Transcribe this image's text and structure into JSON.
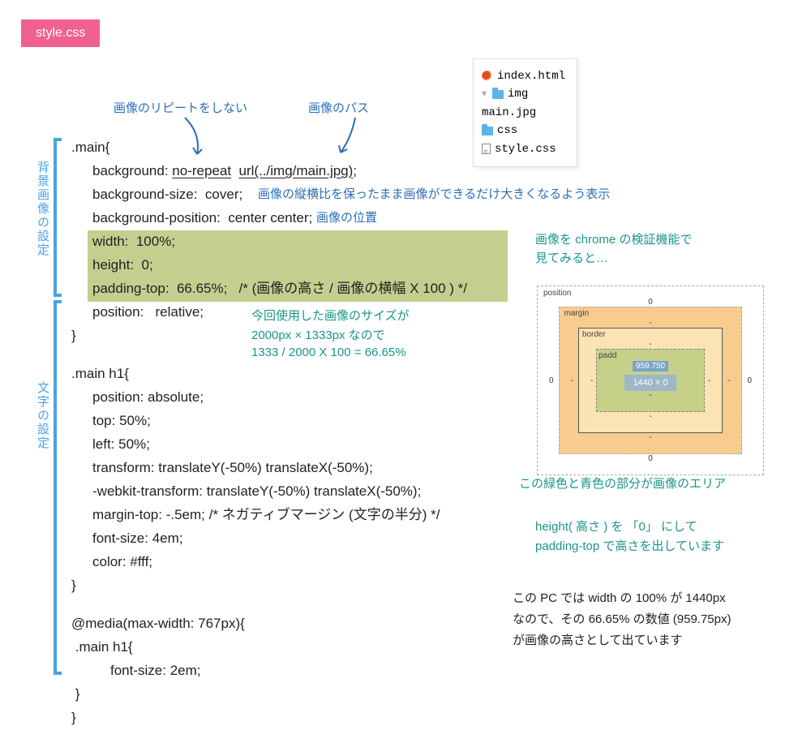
{
  "badge": {
    "label": "style.css"
  },
  "filetree": {
    "items": [
      {
        "icon": "html",
        "name": "index.html",
        "indent": 0
      },
      {
        "icon": "folder",
        "name": "img",
        "indent": 0,
        "expand": true
      },
      {
        "icon": "none",
        "name": "main.jpg",
        "indent": 1
      },
      {
        "icon": "folder",
        "name": "css",
        "indent": 0
      },
      {
        "icon": "css",
        "name": "style.css",
        "indent": 1
      }
    ]
  },
  "annotations": {
    "norepeat": "画像のリピートをしない",
    "path": "画像のパス",
    "cover": "画像の縦横比を保ったまま画像ができるだけ大きくなるよう表示",
    "position": "画像の位置",
    "chrome1": "画像を chrome の検証機能で",
    "chrome2": "見てみると…",
    "calc1": "今回使用した画像のサイズが",
    "calc2": "2000px × 1333px なので",
    "calc3": "1333 / 2000 X 100 = 66.65%",
    "area": "この緑色と青色の部分が画像のエリア",
    "height1": "height( 高さ ) を 「0」 にして",
    "height2": "padding-top で高さを出しています",
    "pc1": "この PC では width の 100% が 1440px",
    "pc2": "なので、その 66.65% の数値 (959.75px)",
    "pc3": "が画像の高さとして出ています"
  },
  "brackets": {
    "bg": "背景画像の設定",
    "text": "文字の設定"
  },
  "code": {
    "l1": ".main{",
    "l2a": "background: ",
    "l2b": "no-repeat",
    "l2c": "  ",
    "l2d": "url(../img/main.jpg)",
    "l2e": ";",
    "l3a": "background-size:  cover;",
    "l4a": "background-position:  center center;",
    "l5": "width:  100%;",
    "l6": "height:  0;",
    "l7": "padding-top:  66.65%;   /* (画像の高さ / 画像の横幅 X 100 ) */",
    "l8": "position:   relative;",
    "l9": "}",
    "l10": ".main h1{",
    "l11": "position: absolute;",
    "l12": "top: 50%;",
    "l13": "left: 50%;",
    "l14": "transform: translateY(-50%) translateX(-50%);",
    "l15": "-webkit-transform: translateY(-50%) translateX(-50%);",
    "l16": "margin-top: -.5em; /* ネガティブマージン (文字の半分) */",
    "l17": "font-size: 4em;",
    "l18": "color: #fff;",
    "l19": "}",
    "l20": "@media(max-width: 767px){",
    "l21": " .main h1{",
    "l22": "font-size: 2em;",
    "l23": " }",
    "l24": "}"
  },
  "boxmodel": {
    "position": "position",
    "margin": "margin",
    "border": "border",
    "padding": "padd",
    "padtop": "959.750",
    "content": "1440 × 0",
    "zero": "0",
    "dash": "-"
  }
}
